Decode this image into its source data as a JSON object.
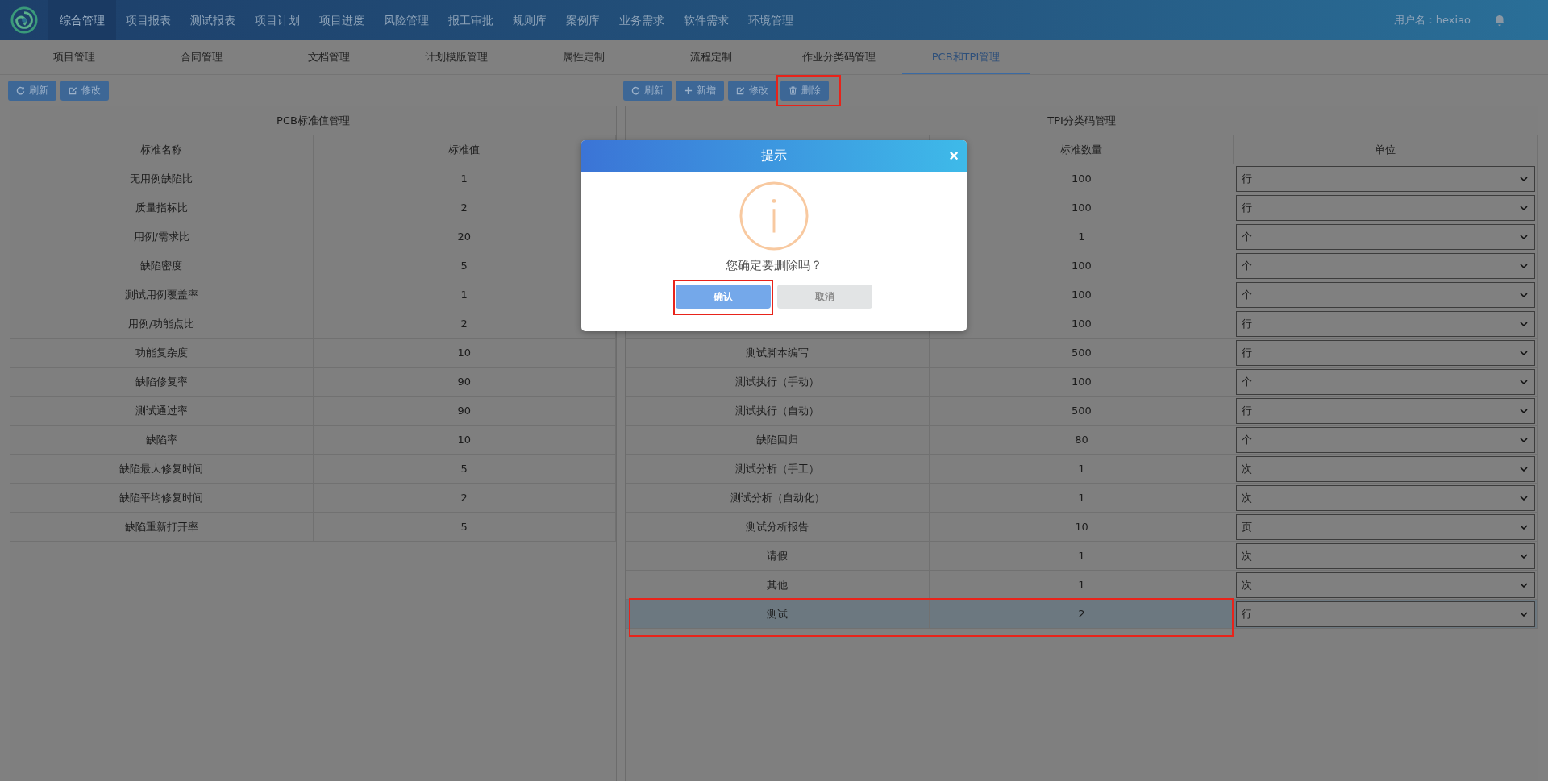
{
  "nav": {
    "items": [
      {
        "label": "综合管理",
        "selected": true
      },
      {
        "label": "项目报表",
        "selected": false
      },
      {
        "label": "测试报表",
        "selected": false
      },
      {
        "label": "项目计划",
        "selected": false
      },
      {
        "label": "项目进度",
        "selected": false
      },
      {
        "label": "风险管理",
        "selected": false
      },
      {
        "label": "报工审批",
        "selected": false
      },
      {
        "label": "规则库",
        "selected": false
      },
      {
        "label": "案例库",
        "selected": false
      },
      {
        "label": "业务需求",
        "selected": false
      },
      {
        "label": "软件需求",
        "selected": false
      },
      {
        "label": "环境管理",
        "selected": false
      }
    ],
    "user": "用户名：hexiao"
  },
  "subtabs": [
    {
      "label": "项目管理",
      "selected": false
    },
    {
      "label": "合同管理",
      "selected": false
    },
    {
      "label": "文档管理",
      "selected": false
    },
    {
      "label": "计划模版管理",
      "selected": false
    },
    {
      "label": "属性定制",
      "selected": false
    },
    {
      "label": "流程定制",
      "selected": false
    },
    {
      "label": "作业分类码管理",
      "selected": false
    },
    {
      "label": "PCB和TPI管理",
      "selected": true
    }
  ],
  "pcb": {
    "toolbar": [
      {
        "kind": "refresh",
        "label": "刷新"
      },
      {
        "kind": "edit",
        "label": "修改"
      }
    ],
    "title": "PCB标准值管理",
    "columns": [
      "标准名称",
      "标准值"
    ],
    "rows": [
      {
        "name": "无用例缺陷比",
        "value": "1"
      },
      {
        "name": "质量指标比",
        "value": "2"
      },
      {
        "name": "用例/需求比",
        "value": "20"
      },
      {
        "name": "缺陷密度",
        "value": "5"
      },
      {
        "name": "测试用例覆盖率",
        "value": "1"
      },
      {
        "name": "用例/功能点比",
        "value": "2"
      },
      {
        "name": "功能复杂度",
        "value": "10"
      },
      {
        "name": "缺陷修复率",
        "value": "90"
      },
      {
        "name": "测试通过率",
        "value": "90"
      },
      {
        "name": "缺陷率",
        "value": "10"
      },
      {
        "name": "缺陷最大修复时间",
        "value": "5"
      },
      {
        "name": "缺陷平均修复时间",
        "value": "2"
      },
      {
        "name": "缺陷重新打开率",
        "value": "5"
      }
    ]
  },
  "tpi": {
    "toolbar": [
      {
        "kind": "refresh",
        "label": "刷新",
        "highlighted": false
      },
      {
        "kind": "add",
        "label": "新增",
        "highlighted": false
      },
      {
        "kind": "edit",
        "label": "修改",
        "highlighted": false
      },
      {
        "kind": "delete",
        "label": "删除",
        "highlighted": true
      }
    ],
    "title": "TPI分类码管理",
    "columns": [
      "标准数量",
      "单位"
    ],
    "rows": [
      {
        "count": "100",
        "unit": "行",
        "selected": false,
        "highlighted": false
      },
      {
        "count": "100",
        "unit": "行",
        "selected": false,
        "highlighted": false
      },
      {
        "count": "1",
        "unit": "个",
        "selected": false,
        "highlighted": false
      },
      {
        "count": "100",
        "unit": "个",
        "selected": false,
        "highlighted": false
      },
      {
        "count": "100",
        "unit": "个",
        "selected": false,
        "highlighted": false
      },
      {
        "count": "100",
        "unit": "行",
        "selected": false,
        "highlighted": false
      },
      {
        "name": "测试脚本编写",
        "count": "500",
        "unit": "行",
        "selected": false,
        "highlighted": false
      },
      {
        "name": "测试执行（手动）",
        "count": "100",
        "unit": "个",
        "selected": false,
        "highlighted": false
      },
      {
        "name": "测试执行（自动）",
        "count": "500",
        "unit": "行",
        "selected": false,
        "highlighted": false
      },
      {
        "name": "缺陷回归",
        "count": "80",
        "unit": "个",
        "selected": false,
        "highlighted": false
      },
      {
        "name": "测试分析（手工）",
        "count": "1",
        "unit": "次",
        "selected": false,
        "highlighted": false
      },
      {
        "name": "测试分析（自动化）",
        "count": "1",
        "unit": "次",
        "selected": false,
        "highlighted": false
      },
      {
        "name": "测试分析报告",
        "count": "10",
        "unit": "页",
        "selected": false,
        "highlighted": false
      },
      {
        "name": "请假",
        "count": "1",
        "unit": "次",
        "selected": false,
        "highlighted": false
      },
      {
        "name": "其他",
        "count": "1",
        "unit": "次",
        "selected": false,
        "highlighted": false
      },
      {
        "name": "测试",
        "count": "2",
        "unit": "行",
        "selected": true,
        "highlighted": true
      }
    ]
  },
  "dialog": {
    "title": "提示",
    "close": "×",
    "message": "您确定要删除吗？",
    "buttons": [
      {
        "kind": "primary",
        "label": "确认",
        "highlighted": true
      },
      {
        "kind": "secondary",
        "label": "取消",
        "highlighted": false
      }
    ]
  }
}
